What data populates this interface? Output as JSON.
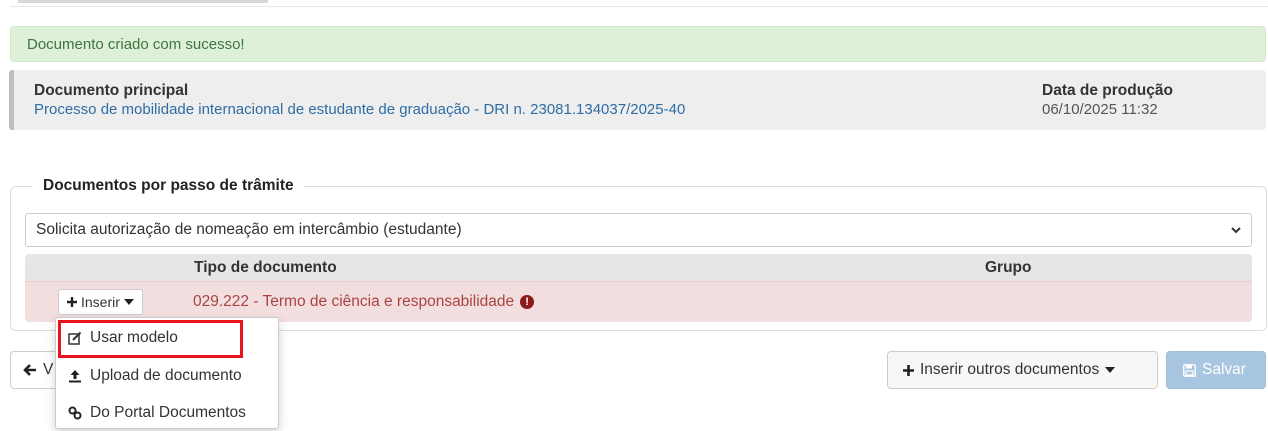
{
  "alert": {
    "text": "Documento criado com sucesso!"
  },
  "document": {
    "main_label": "Documento principal",
    "main_value": "Processo de mobilidade internacional de estudante de graduação - DRI n. 23081.134037/2025-40",
    "date_label": "Data de produção",
    "date_value": "06/10/2025 11:32"
  },
  "step_section": {
    "legend": "Documentos por passo de trâmite",
    "selected_step": "Solicita autorização de nomeação em intercâmbio (estudante)"
  },
  "table": {
    "headers": {
      "tipo": "Tipo de documento",
      "grupo": "Grupo"
    },
    "rows": [
      {
        "insert_label": "Inserir",
        "doc_type": "029.222 - Termo de ciência e responsabilidade",
        "group": ""
      }
    ]
  },
  "dropdown": {
    "items": [
      {
        "label": "Usar modelo",
        "icon": "edit-icon"
      },
      {
        "label": "Upload de documento",
        "icon": "upload-icon"
      },
      {
        "label": "Do Portal Documentos",
        "icon": "link-icon"
      }
    ]
  },
  "footer": {
    "back_label": "V",
    "other_docs_label": "Inserir outros documentos",
    "save_label": "Salvar"
  },
  "colors": {
    "success_bg": "#dff0d8",
    "error_row_bg": "#f2dede",
    "highlight": "#e8141b",
    "link_blue": "#2e6da4"
  }
}
